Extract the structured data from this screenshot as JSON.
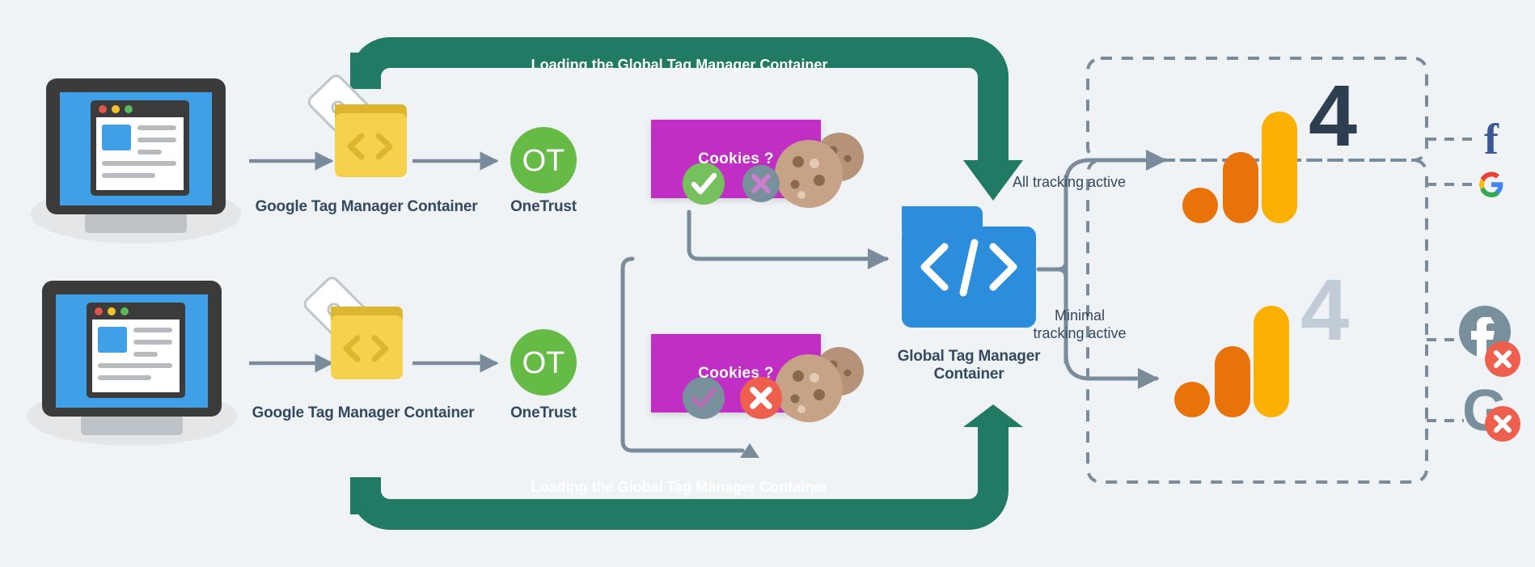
{
  "diagram": {
    "background_color": "#eff3f6",
    "title_bar_top": "Loading the Global Tag Manager Container",
    "title_bar_bottom": "Loading the Global Tag Manager Container",
    "colors": {
      "green_banner": "#207a64",
      "gtm_yellow": "#f5d14e",
      "gtm_yellow_dark": "#ddb52f",
      "global_blue": "#2b8ddb",
      "onetrust_green": "#66bb47",
      "cookie_magenta": "#c12fc4",
      "accept_green": "#76c15e",
      "deny_red": "#ee5f4e",
      "disabled_grey": "#78909c",
      "connector_grey": "#7a8c9b",
      "ga4_orange": "#e8730b",
      "ga4_yellow": "#fbb003",
      "ga4_dark": "#2c3e50",
      "ga4_grey": "#c2ccd6",
      "facebook_blue": "#3b5998",
      "laptop_dark": "#3b3b3b",
      "laptop_screen": "#3fa0e8"
    },
    "rows": [
      {
        "id": "consent-accepted",
        "website_label": "",
        "gtm_label": "Google Tag Manager Container",
        "onetrust_initials": "OT",
        "onetrust_label": "OneTrust",
        "cookie_banner_text": "Cookies ?",
        "accept_state": "active",
        "deny_state": "inactive",
        "route_label": "All tracking active",
        "ga4_state": "active",
        "vendors": [
          {
            "name": "facebook",
            "glyph": "f",
            "blocked": false
          },
          {
            "name": "google",
            "glyph": "G",
            "blocked": false
          }
        ]
      },
      {
        "id": "consent-declined",
        "website_label": "",
        "gtm_label": "Google Tag Manager Container",
        "onetrust_initials": "OT",
        "onetrust_label": "OneTrust",
        "cookie_banner_text": "Cookies ?",
        "accept_state": "inactive",
        "deny_state": "active",
        "route_label": "Minimal\ntracking active",
        "ga4_state": "blocked",
        "vendors": [
          {
            "name": "facebook",
            "glyph": "f",
            "blocked": true
          },
          {
            "name": "google",
            "glyph": "G",
            "blocked": true
          }
        ]
      }
    ],
    "center": {
      "global_container_label": "Global Tag Manager\nContainer",
      "icon": "code-folder-icon"
    },
    "ga4": {
      "digit": "4",
      "icon": "google-analytics-4-icon"
    }
  }
}
